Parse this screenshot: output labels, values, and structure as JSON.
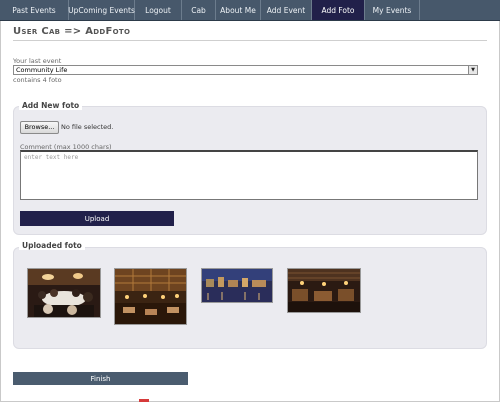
{
  "nav": {
    "items": [
      {
        "label": "Past Events"
      },
      {
        "label": "UpComing Events"
      },
      {
        "label": "Logout"
      },
      {
        "label": "Cab"
      },
      {
        "label": "About Me"
      },
      {
        "label": "Add Event"
      },
      {
        "label": "Add Foto",
        "active": true
      },
      {
        "label": "My Events"
      }
    ]
  },
  "page": {
    "title": "User Cab => AddFoto"
  },
  "event_select": {
    "label": "Your last event",
    "value": "Community Life",
    "count_text": "contains 4 foto"
  },
  "add_panel": {
    "legend": "Add New foto",
    "browse_label": "Browse...",
    "file_status": "No file selected.",
    "comment_label": "Comment (max 1000 chars)",
    "comment_placeholder": "enter text here",
    "upload_label": "Upload"
  },
  "uploaded_panel": {
    "legend": "Uploaded foto",
    "photos": [
      "banquet hall dinner",
      "ornate restaurant interior",
      "city waterfront at night",
      "dining room with wooden ceiling"
    ]
  },
  "finish_label": "Finish",
  "colors": {
    "nav_bg": "#47586b",
    "nav_active": "#21204a",
    "upload_button": "#21204a",
    "finish_button": "#4a5c6f"
  }
}
